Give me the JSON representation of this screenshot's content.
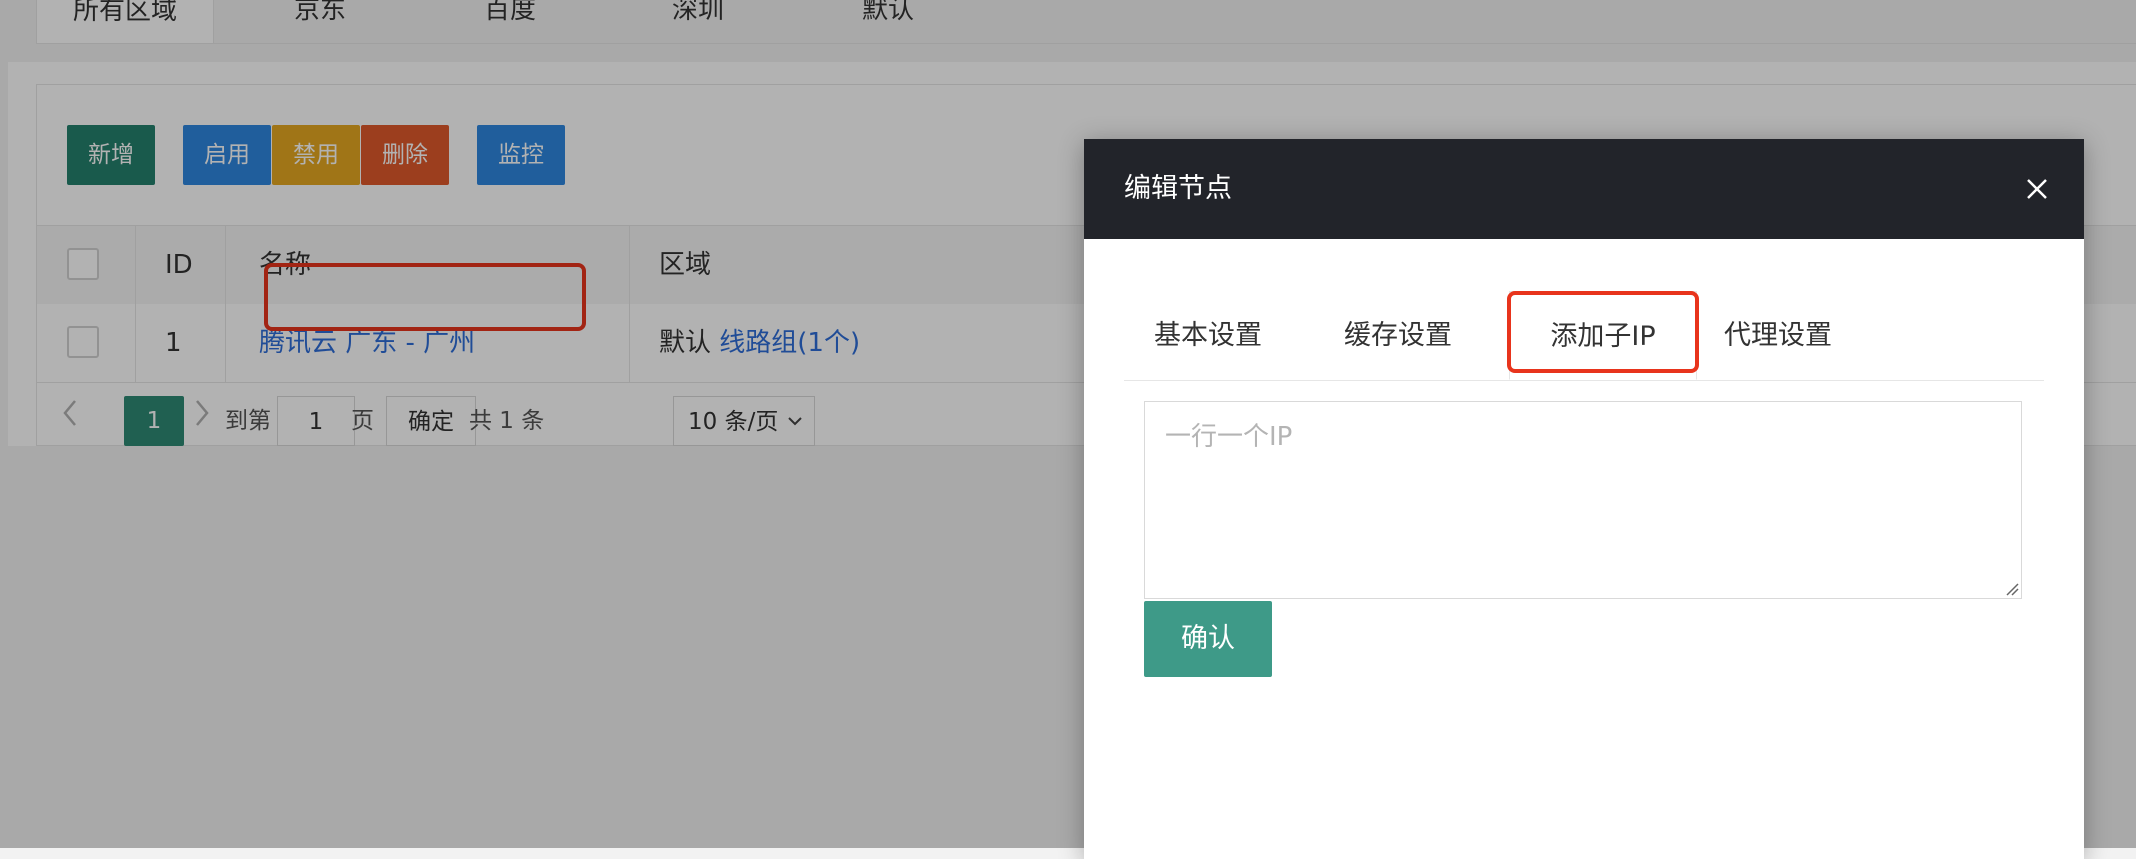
{
  "region_tabs": [
    "所有区域",
    "京东",
    "百度",
    "深圳",
    "默认"
  ],
  "toolbar": {
    "new_label": "新增",
    "enable_label": "启用",
    "disable_label": "禁用",
    "delete_label": "删除",
    "monitor_label": "监控"
  },
  "table": {
    "columns": [
      "ID",
      "名称",
      "区域"
    ],
    "rows": [
      {
        "id": "1",
        "name": "腾讯云 广东 - 广州",
        "region_prefix": "默认",
        "region_link": "线路组(1个)"
      }
    ]
  },
  "pager": {
    "prev_icon": "chevron-left-icon",
    "next_icon": "chevron-right-icon",
    "current_page": "1",
    "goto_label": "到第",
    "goto_value": "1",
    "page_unit": "页",
    "confirm_label": "确定",
    "total_label": "共 1 条",
    "page_size": "10 条/页"
  },
  "modal": {
    "title": "编辑节点",
    "close_icon": "close-icon",
    "tabs": [
      "基本设置",
      "缓存设置",
      "添加子IP",
      "代理设置"
    ],
    "active_tab": "添加子IP",
    "textarea_placeholder": "一行一个IP",
    "confirm_label": "确认"
  },
  "colors": {
    "primary_green": "#24816e",
    "blue": "#2e87e0",
    "yellow": "#e6a822",
    "red": "#e05a2b",
    "highlight_red": "#e8341c",
    "modal_header": "#22242a"
  }
}
